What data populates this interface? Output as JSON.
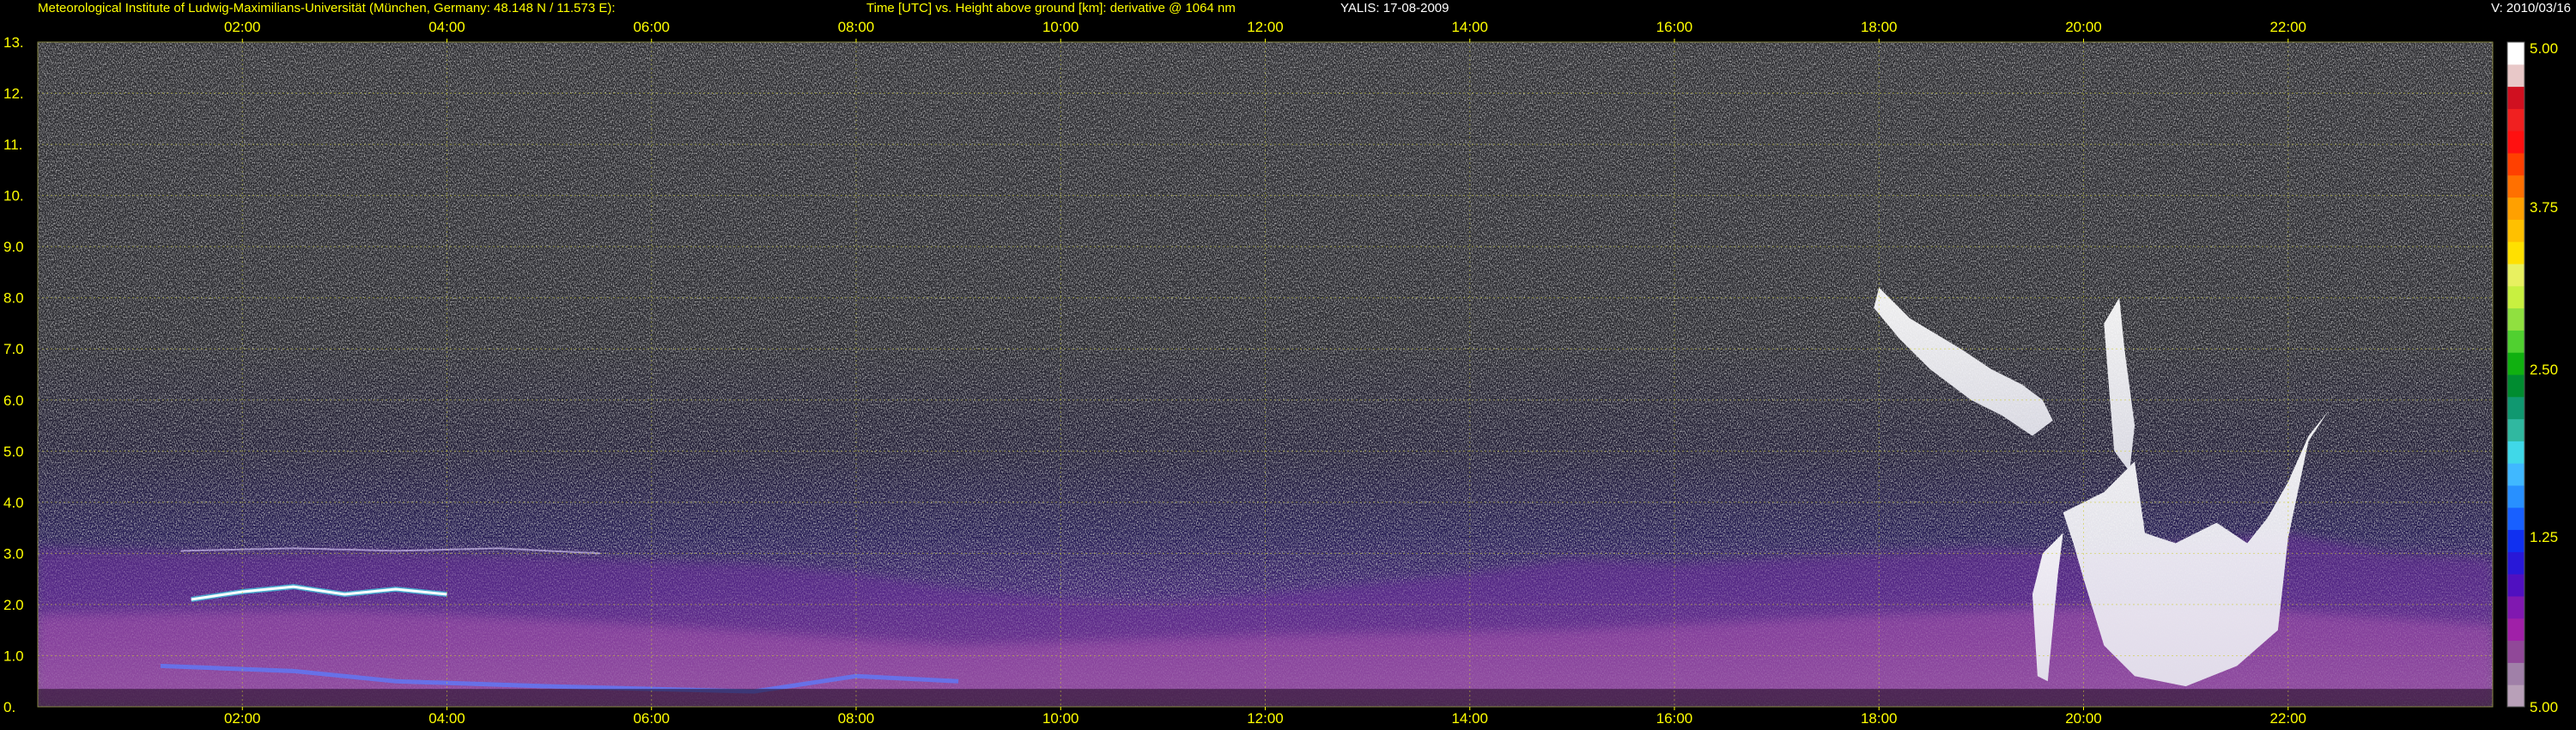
{
  "header": {
    "institute": "Meteorological Institute of Ludwig-Maximilians-Universität (München, Germany: 48.148 N / 11.573 E):",
    "plot_title": "Time [UTC] vs. Height above ground [km]: derivative @ 1064 nm",
    "instrument_date": "YALIS: 17-08-2009",
    "version": "V: 2010/03/16"
  },
  "chart_data": {
    "type": "heatmap",
    "title": "Time [UTC] vs. Height above ground [km]: derivative @ 1064 nm",
    "xlabel": "Time [UTC]",
    "ylabel": "Height above ground [km]",
    "xlim": [
      0.0,
      24.0
    ],
    "ylim": [
      0.0,
      13.0
    ],
    "x_ticks": [
      2,
      4,
      6,
      8,
      10,
      12,
      14,
      16,
      18,
      20,
      22
    ],
    "x_tick_labels": [
      "02:00",
      "04:00",
      "06:00",
      "08:00",
      "10:00",
      "12:00",
      "14:00",
      "16:00",
      "18:00",
      "20:00",
      "22:00"
    ],
    "y_ticks": [
      0,
      1,
      2,
      3,
      4,
      5,
      6,
      7,
      8,
      9,
      10,
      11,
      12,
      13
    ],
    "y_tick_labels": [
      "0.",
      "1.0",
      "2.0",
      "3.0",
      "4.0",
      "5.0",
      "6.0",
      "7.0",
      "8.0",
      "9.0",
      "10.",
      "11.",
      "12.",
      "13."
    ],
    "grid": true,
    "grid_color": "#cccc33",
    "colorbar": {
      "position": "right",
      "ticks": [
        5.0,
        1.25,
        2.5,
        3.75,
        5.0
      ],
      "tick_labels": [
        "5.00",
        "1.25",
        "2.50",
        "3.75",
        "5.00"
      ],
      "colors_bottom_to_top": [
        "#b8a0b8",
        "#a080a8",
        "#904898",
        "#a020a8",
        "#8018b0",
        "#5010c0",
        "#2818d8",
        "#1030f0",
        "#1860ff",
        "#2890ff",
        "#40b8ff",
        "#40d8e8",
        "#30b8a0",
        "#109870",
        "#008c30",
        "#10b010",
        "#50d030",
        "#90e040",
        "#c8f040",
        "#e8f060",
        "#ffe000",
        "#ffc000",
        "#ffa000",
        "#ff7000",
        "#ff4000",
        "#ff1010",
        "#f02020",
        "#d01020",
        "#e8c8c8",
        "#ffffff"
      ]
    },
    "features": [
      {
        "name": "aerosol boundary layer",
        "x_range": [
          0.0,
          24.0
        ],
        "height_top_km": [
          2.5,
          3.2
        ]
      },
      {
        "name": "lofted aerosol layer",
        "x_range": [
          1.5,
          4.0
        ],
        "height_km": 2.3
      },
      {
        "name": "cloud layer",
        "x_range": [
          18.0,
          19.8
        ],
        "height_km": [
          5.0,
          8.0
        ]
      },
      {
        "name": "cloud layer",
        "x_range": [
          19.8,
          22.5
        ],
        "height_km": [
          1.0,
          6.0
        ]
      }
    ]
  },
  "colors": {
    "background": "#000000",
    "header_text": "#ffff00",
    "tick_text": "#ffff00",
    "noise_gray": "#8c8c8c"
  }
}
